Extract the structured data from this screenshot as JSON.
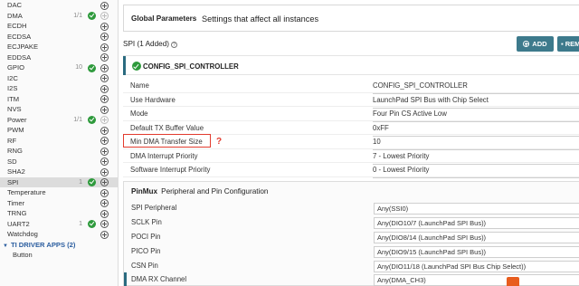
{
  "sidebar": {
    "items": [
      {
        "label": "DAC",
        "count": "",
        "added": false,
        "addable": true
      },
      {
        "label": "DMA",
        "count": "1/1",
        "added": true,
        "addable": false
      },
      {
        "label": "ECDH",
        "count": "",
        "added": false,
        "addable": true
      },
      {
        "label": "ECDSA",
        "count": "",
        "added": false,
        "addable": true
      },
      {
        "label": "ECJPAKE",
        "count": "",
        "added": false,
        "addable": true
      },
      {
        "label": "EDDSA",
        "count": "",
        "added": false,
        "addable": true
      },
      {
        "label": "GPIO",
        "count": "10",
        "added": true,
        "addable": true
      },
      {
        "label": "I2C",
        "count": "",
        "added": false,
        "addable": true
      },
      {
        "label": "I2S",
        "count": "",
        "added": false,
        "addable": true
      },
      {
        "label": "ITM",
        "count": "",
        "added": false,
        "addable": true
      },
      {
        "label": "NVS",
        "count": "",
        "added": false,
        "addable": true
      },
      {
        "label": "Power",
        "count": "1/1",
        "added": true,
        "addable": false
      },
      {
        "label": "PWM",
        "count": "",
        "added": false,
        "addable": true
      },
      {
        "label": "RF",
        "count": "",
        "added": false,
        "addable": true
      },
      {
        "label": "RNG",
        "count": "",
        "added": false,
        "addable": true
      },
      {
        "label": "SD",
        "count": "",
        "added": false,
        "addable": true
      },
      {
        "label": "SHA2",
        "count": "",
        "added": false,
        "addable": true
      },
      {
        "label": "SPI",
        "count": "1",
        "added": true,
        "addable": true,
        "selected": true
      },
      {
        "label": "Temperature",
        "count": "",
        "added": false,
        "addable": true
      },
      {
        "label": "Timer",
        "count": "",
        "added": false,
        "addable": true
      },
      {
        "label": "TRNG",
        "count": "",
        "added": false,
        "addable": true
      },
      {
        "label": "UART2",
        "count": "1",
        "added": true,
        "addable": true
      },
      {
        "label": "Watchdog",
        "count": "",
        "added": false,
        "addable": true
      }
    ],
    "group": {
      "label": "TI DRIVER APPS (2)"
    },
    "subitem": {
      "label": "Button"
    }
  },
  "global": {
    "title": "Global Parameters",
    "description": "Settings that affect all instances"
  },
  "module": {
    "title": "SPI (1 Added)",
    "help": "?",
    "add_label": "ADD",
    "remove_label": "REM"
  },
  "instance": {
    "name": "CONFIG_SPI_CONTROLLER"
  },
  "params": [
    {
      "label": "Name",
      "value": "CONFIG_SPI_CONTROLLER"
    },
    {
      "label": "Use Hardware",
      "value": "LaunchPad SPI Bus with Chip Select"
    },
    {
      "label": "Mode",
      "value": "Four Pin CS Active Low"
    },
    {
      "label": "Default TX Buffer Value",
      "value": "0xFF"
    },
    {
      "label": "Min DMA Transfer Size",
      "value": "10"
    },
    {
      "label": "DMA Interrupt Priority",
      "value": "7 - Lowest Priority"
    },
    {
      "label": "Software Interrupt Priority",
      "value": "0 - Lowest Priority"
    }
  ],
  "annotation": {
    "mark": "?"
  },
  "pinmux": {
    "title": "PinMux",
    "description": "Peripheral and Pin Configuration",
    "rows": [
      {
        "label": "SPI Peripheral",
        "value": "Any(SSI0)"
      },
      {
        "label": "SCLK Pin",
        "value": "Any(DIO10/7 (LaunchPad SPI Bus))"
      },
      {
        "label": "POCI Pin",
        "value": "Any(DIO8/14 (LaunchPad SPI Bus))"
      },
      {
        "label": "PICO Pin",
        "value": "Any(DIO9/15 (LaunchPad SPI Bus))"
      },
      {
        "label": "CSN Pin",
        "value": "Any(DIO11/18 (LaunchPad SPI Bus Chip Select))"
      },
      {
        "label": "DMA RX Channel",
        "value": "Any(DMA_CH3)"
      }
    ]
  },
  "colors": {
    "accent": "#3d7a8c",
    "check": "#2e9a3c",
    "annotation": "#e23b2e",
    "group_text": "#2a5d9f"
  }
}
